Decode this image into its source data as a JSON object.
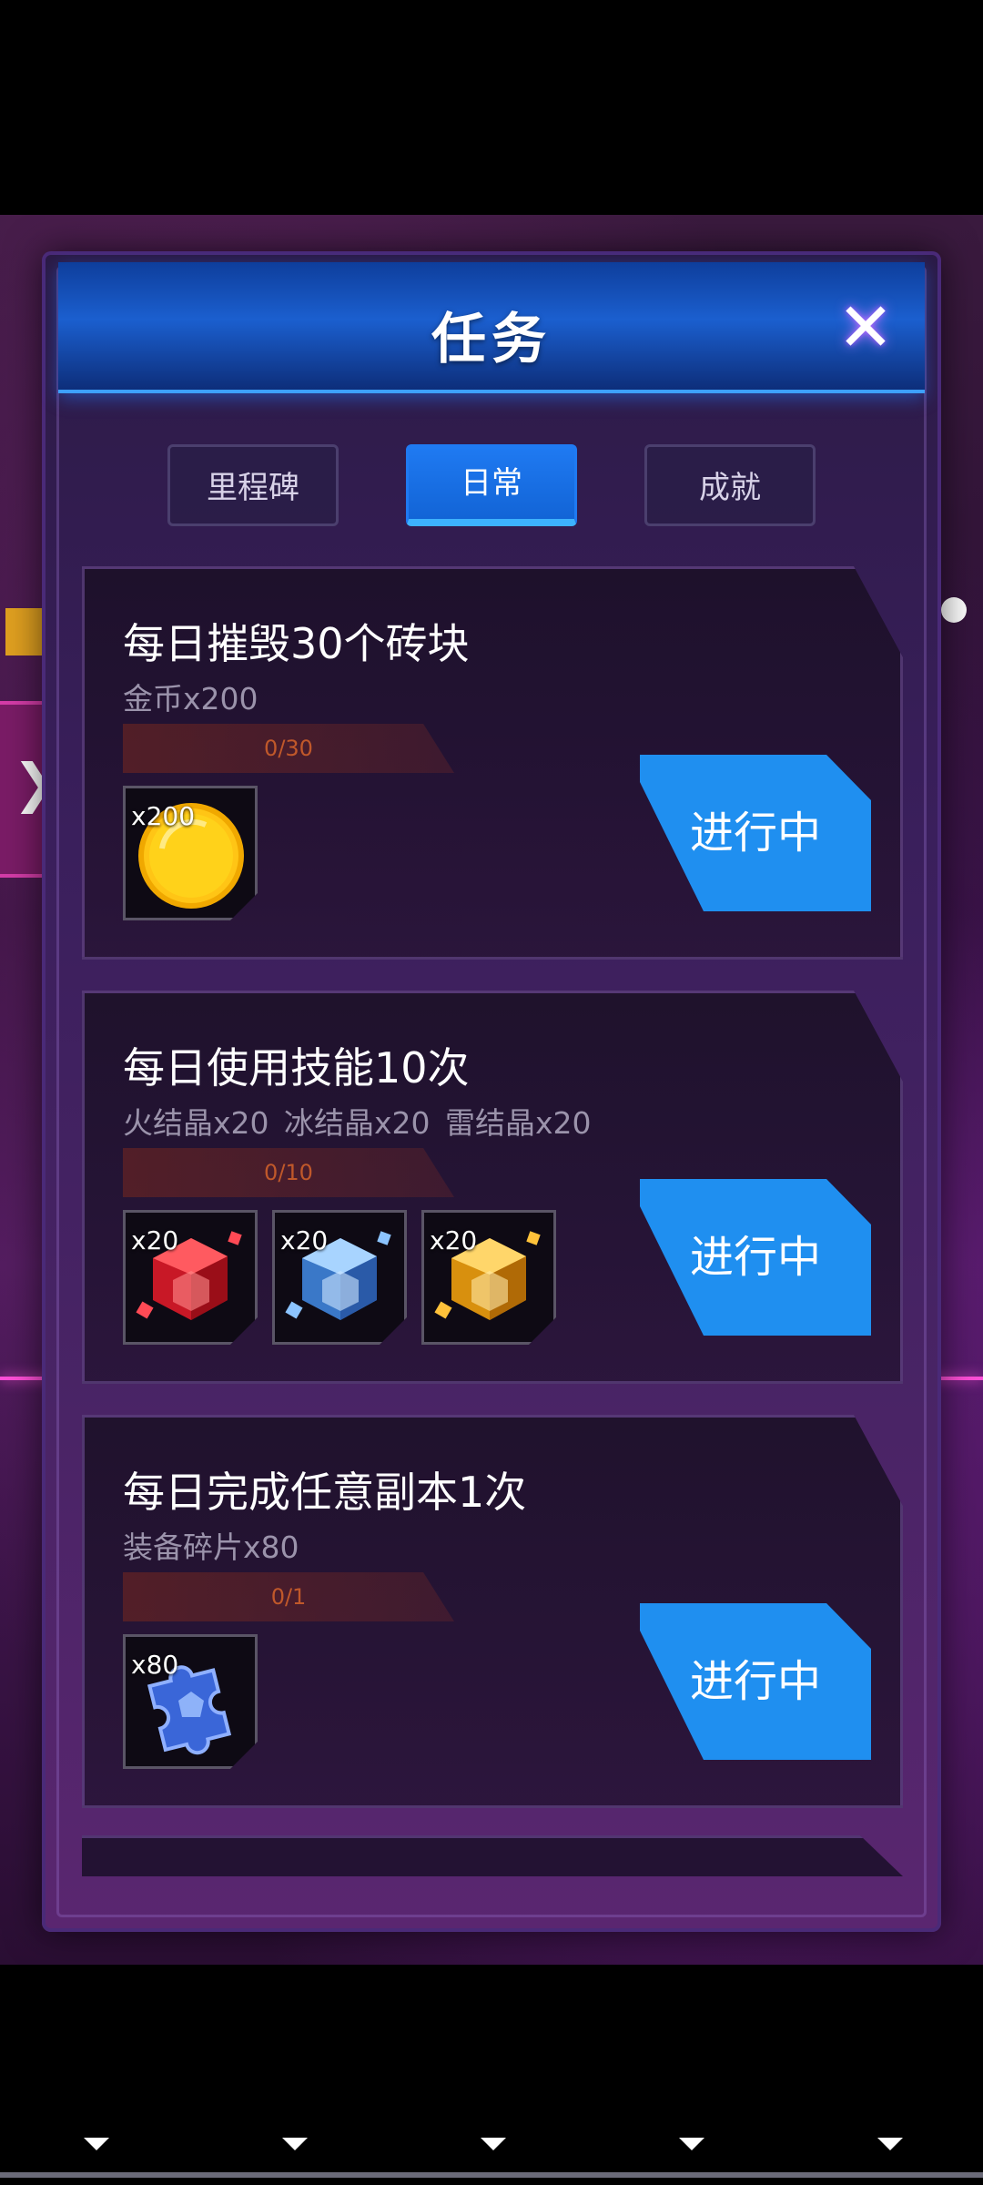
{
  "modal": {
    "title": "任务",
    "close_icon": "close-icon"
  },
  "tabs": [
    {
      "label": "里程碑",
      "active": false
    },
    {
      "label": "日常",
      "active": true
    },
    {
      "label": "成就",
      "active": false
    }
  ],
  "tasks": [
    {
      "title": "每日摧毁30个砖块",
      "reward": "金币x200",
      "progress_text": "0/30",
      "progress": 0,
      "items": [
        {
          "icon": "gold-coin-icon",
          "count": "x200"
        }
      ],
      "status": "进行中"
    },
    {
      "title": "每日使用技能10次",
      "reward": "火结晶x20  冰结晶x20  雷结晶x20",
      "progress_text": "0/10",
      "progress": 0,
      "items": [
        {
          "icon": "fire-crystal-icon",
          "count": "x20"
        },
        {
          "icon": "ice-crystal-icon",
          "count": "x20"
        },
        {
          "icon": "thunder-crystal-icon",
          "count": "x20"
        }
      ],
      "status": "进行中"
    },
    {
      "title": "每日完成任意副本1次",
      "reward": "装备碎片x80",
      "progress_text": "0/1",
      "progress": 0,
      "items": [
        {
          "icon": "equipment-fragment-icon",
          "count": "x80"
        }
      ],
      "status": "进行中"
    }
  ],
  "colors": {
    "accent_blue": "#1f8ff0",
    "modal_purple": "#3a1f5c",
    "progress_text": "#c0582a",
    "reward_text": "#9b93ab"
  }
}
